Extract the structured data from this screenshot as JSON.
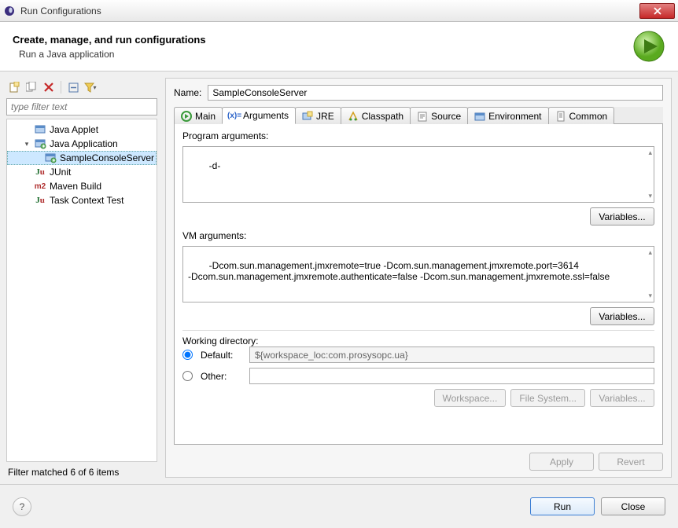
{
  "window": {
    "title": "Run Configurations"
  },
  "header": {
    "title": "Create, manage, and run configurations",
    "subtitle": "Run a Java application"
  },
  "left": {
    "filter_placeholder": "type filter text",
    "items": [
      {
        "label": "Java Applet",
        "icon": "applet",
        "indent": 1,
        "exp": ""
      },
      {
        "label": "Java Application",
        "icon": "app",
        "indent": 1,
        "exp": "▾"
      },
      {
        "label": "SampleConsoleServer",
        "icon": "app",
        "indent": 2,
        "exp": "",
        "selected": true
      },
      {
        "label": "JUnit",
        "icon": "junit",
        "indent": 1,
        "exp": ""
      },
      {
        "label": "Maven Build",
        "icon": "maven",
        "indent": 1,
        "exp": ""
      },
      {
        "label": "Task Context Test",
        "icon": "junit-task",
        "indent": 1,
        "exp": ""
      }
    ],
    "filter_status": "Filter matched 6 of 6 items"
  },
  "right": {
    "name_label": "Name:",
    "name_value": "SampleConsoleServer",
    "tabs": [
      {
        "label": "Main",
        "icon": "main"
      },
      {
        "label": "Arguments",
        "icon": "args",
        "active": true
      },
      {
        "label": "JRE",
        "icon": "jre"
      },
      {
        "label": "Classpath",
        "icon": "classpath"
      },
      {
        "label": "Source",
        "icon": "source"
      },
      {
        "label": "Environment",
        "icon": "env"
      },
      {
        "label": "Common",
        "icon": "common"
      }
    ],
    "prog_args_label": "Program arguments:",
    "prog_args_value": "-d-",
    "variables_label": "Variables...",
    "vm_args_label": "VM arguments:",
    "vm_args_value": "-Dcom.sun.management.jmxremote=true -Dcom.sun.management.jmxremote.port=3614\n-Dcom.sun.management.jmxremote.authenticate=false -Dcom.sun.management.jmxremote.ssl=false",
    "workdir_label": "Working directory:",
    "workdir_default_label": "Default:",
    "workdir_default_value": "${workspace_loc:com.prosysopc.ua}",
    "workdir_other_label": "Other:",
    "workspace_btn": "Workspace...",
    "filesystem_btn": "File System...",
    "apply_btn": "Apply",
    "revert_btn": "Revert"
  },
  "footer": {
    "run": "Run",
    "close": "Close"
  }
}
